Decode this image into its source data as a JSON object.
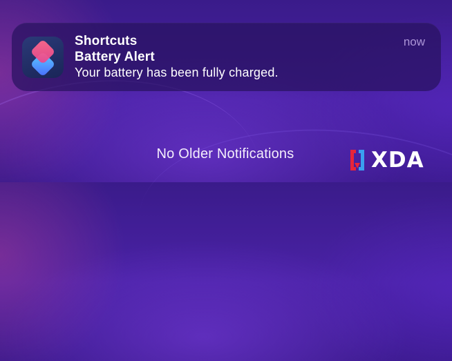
{
  "notification": {
    "app_name": "Shortcuts",
    "title": "Battery Alert",
    "body": "Your battery has been fully charged.",
    "timestamp": "now",
    "app_icon": "shortcuts-icon"
  },
  "notification_center": {
    "empty_message": "No Older Notifications"
  },
  "watermark": {
    "text": "XDA",
    "icon": "xda-bracket-logo",
    "accent_color": "#e8253a"
  },
  "colors": {
    "wallpaper": "#4a22a6",
    "card": "#28125f",
    "timestamp": "#dcc8ff"
  }
}
